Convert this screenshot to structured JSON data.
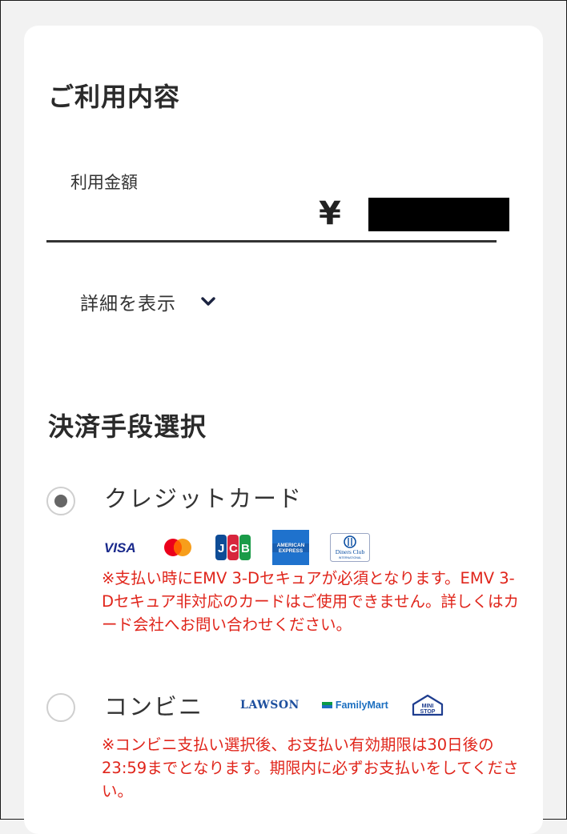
{
  "usage": {
    "title": "ご利用内容",
    "amount_label": "利用金額",
    "currency_symbol": "¥",
    "details_label": "詳細を表示"
  },
  "payment": {
    "title": "決済手段選択",
    "options": [
      {
        "label": "クレジットカード",
        "selected": true,
        "brands": [
          "VISA",
          "Mastercard",
          "JCB",
          "AMERICAN EXPRESS",
          "Diners Club INTERNATIONAL"
        ],
        "notice": "※支払い時にEMV 3-Dセキュアが必須となります。EMV 3-Dセキュア非対応のカードはご使用できません。詳しくはカード会社へお問い合わせください。"
      },
      {
        "label": "コンビニ",
        "selected": false,
        "stores": [
          "LAWSON",
          "FamilyMart",
          "MINI STOP"
        ],
        "notice": "※コンビニ支払い選択後、お支払い有効期限は30日後の23:59までとなります。期限内に必ずお支払いをしてください。"
      }
    ]
  },
  "colors": {
    "notice": "#e0251b",
    "background": "#f2f2f2",
    "card": "#ffffff",
    "radio_dot": "#666666"
  },
  "icons": [
    "chevron-down-icon",
    "visa-icon",
    "mastercard-icon",
    "jcb-icon",
    "amex-icon",
    "diners-club-icon",
    "lawson-logo",
    "familymart-logo",
    "ministop-logo"
  ]
}
